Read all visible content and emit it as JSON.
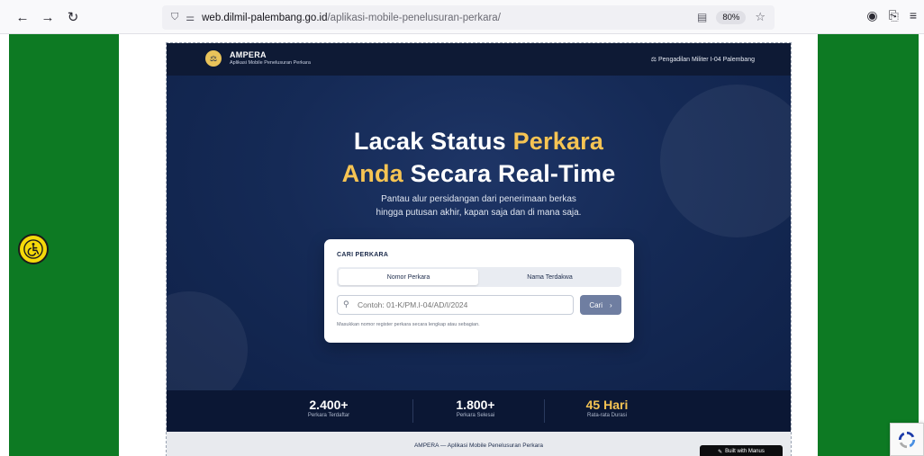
{
  "browser": {
    "url_domain": "web.dilmil-palembang.go.id",
    "url_path": "/aplikasi-mobile-penelusuran-perkara/",
    "zoom": "80%",
    "icons": [
      "back-icon",
      "forward-icon",
      "reload-icon",
      "shield-icon",
      "permissions-icon",
      "reader-view-icon",
      "bookmark-star-icon",
      "account-icon",
      "extensions-icon",
      "menu-icon"
    ]
  },
  "header": {
    "brand_name": "AMPERA",
    "brand_sub": "Aplikasi Mobile Penelusuran Perkara",
    "court": "Pengadilan Militer I-04 Palembang"
  },
  "hero": {
    "title_part1": "Lacak Status ",
    "title_hl1": "Perkara",
    "title_hl2": "Anda",
    "title_part2": " Secara Real-Time",
    "desc_line1": "Pantau alur persidangan dari penerimaan berkas",
    "desc_line2": "hingga putusan akhir, kapan saja dan di mana saja."
  },
  "search": {
    "label": "CARI PERKARA",
    "tab_active": "Nomor Perkara",
    "tab_inactive": "Nama Terdakwa",
    "placeholder": "Contoh: 01-K/PM.I-04/AD/I/2024",
    "button": "Cari",
    "hint": "Masukkan nomor register perkara secara lengkap atau sebagian."
  },
  "stats": [
    {
      "value": "2.400+",
      "label": "Perkara Terdaftar"
    },
    {
      "value": "1.800+",
      "label": "Perkara Selesai"
    },
    {
      "value": "45 Hari",
      "label": "Rata-rata Durasi"
    }
  ],
  "footer": {
    "text": "AMPERA — Aplikasi Mobile Penelusuran Perkara",
    "built": "Built with Manus"
  },
  "colors": {
    "accent": "#f6c453",
    "page_green": "#0d7a23",
    "hero_navy": "#152a56"
  }
}
